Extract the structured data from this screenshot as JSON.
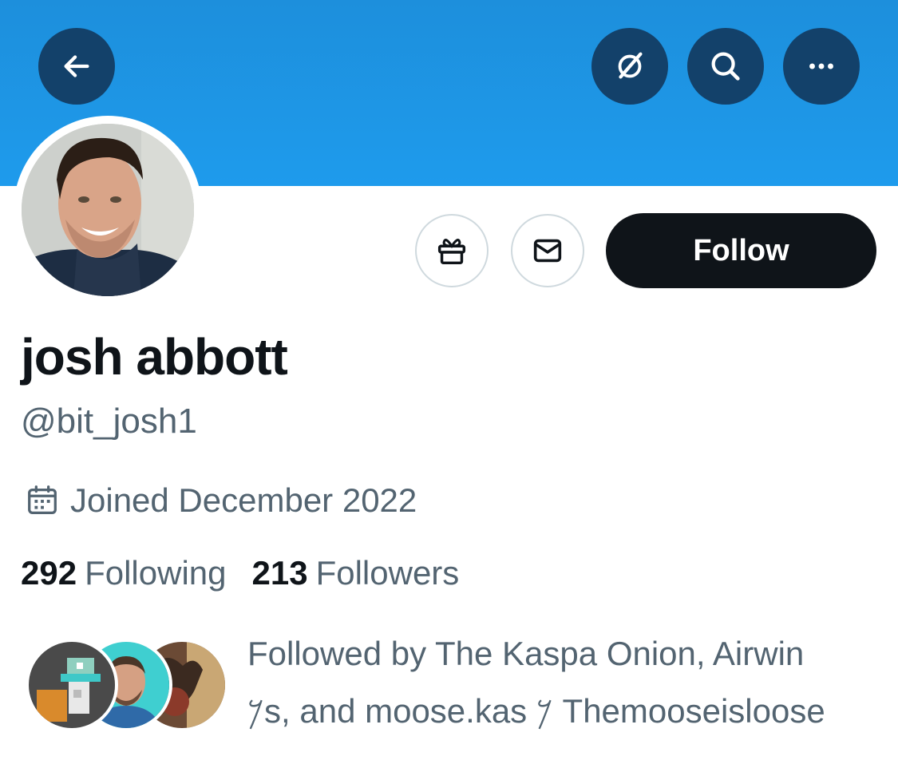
{
  "header": {
    "back_icon": "arrow-left-icon",
    "grok_icon": "grok-icon",
    "search_icon": "search-icon",
    "more_icon": "more-dots-icon",
    "banner_color": "#1d8fdc"
  },
  "actions": {
    "gift_icon": "gift-icon",
    "message_icon": "envelope-icon",
    "follow_label": "Follow"
  },
  "profile": {
    "display_name": "josh abbott",
    "handle": "@bit_josh1",
    "joined": "Joined December 2022",
    "following_count": "292",
    "following_label": "Following",
    "followers_count": "213",
    "followers_label": "Followers",
    "followed_by_line1": "Followed by The Kaspa Onion, Airwin",
    "followed_by_line2": "𐤊s, and moose.kas 𐤊 Themooseisloose"
  },
  "colors": {
    "primary_text": "#0f1419",
    "secondary_text": "#536471",
    "button_dark": "#0f1419"
  }
}
